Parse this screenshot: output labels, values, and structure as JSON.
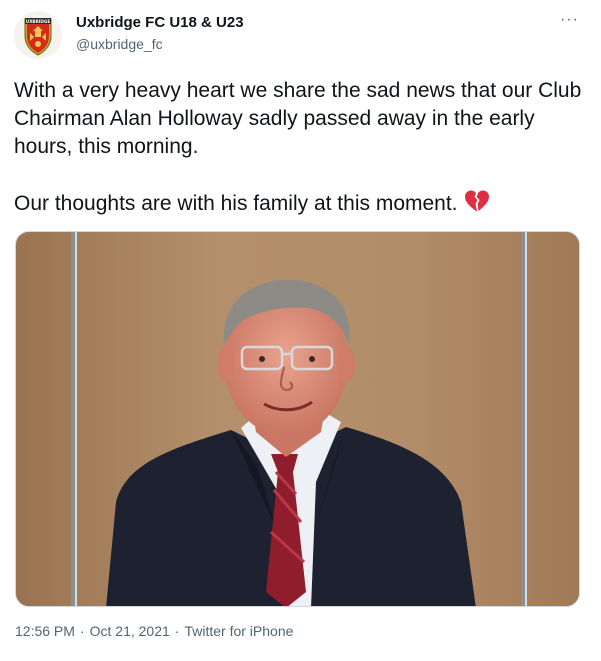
{
  "account": {
    "display_name": "Uxbridge FC U18 & U23",
    "handle": "@uxbridge_fc",
    "avatar_icon": "club-crest-icon",
    "crest_text": "UXBRIDGE"
  },
  "menu": {
    "more_label": "···"
  },
  "tweet": {
    "paragraph_1": "With a very heavy heart we share the sad news that our Club Chairman Alan Holloway sadly passed away in the early hours, this morning.",
    "paragraph_2": "Our thoughts are with his family at this moment.",
    "emoji_icon": "broken-heart-icon"
  },
  "media": {
    "photo_icon": "portrait-photo"
  },
  "meta": {
    "time": "12:56 PM",
    "separator": "·",
    "date": "Oct 21, 2021",
    "source": "Twitter for iPhone"
  },
  "colors": {
    "text": "#0f1419",
    "secondary": "#536471",
    "heart": "#e0245e"
  }
}
